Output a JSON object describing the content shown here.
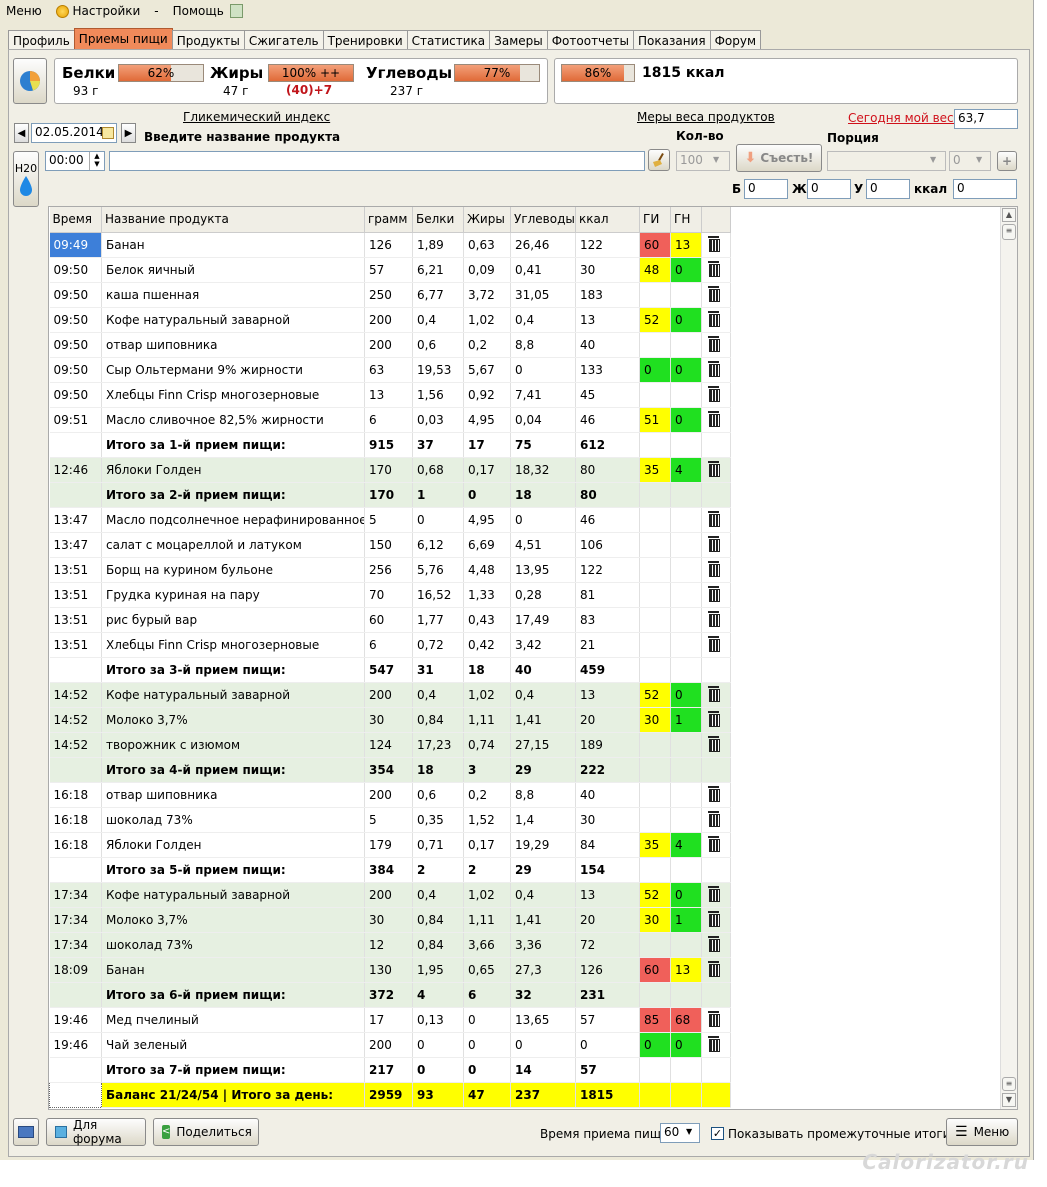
{
  "menu": {
    "menu": "Меню",
    "settings": "Настройки",
    "dash": "-",
    "help": "Помощь"
  },
  "tabs": [
    "Профиль",
    "Приемы пищи",
    "Продукты",
    "Сжигатель",
    "Тренировки",
    "Статистика",
    "Замеры",
    "Фотоотчеты",
    "Показания",
    "Форум"
  ],
  "summary": {
    "protein": {
      "label": "Белки",
      "pct": "62%",
      "fill": 62,
      "grams": "93 г"
    },
    "fat": {
      "label": "Жиры",
      "pct": "100% ++",
      "fill": 100,
      "grams": "47 г",
      "excess": "(40)+7"
    },
    "carbs": {
      "label": "Углеводы",
      "pct": "77%",
      "fill": 77,
      "grams": "237 г"
    },
    "kcal": {
      "pct": "86%",
      "fill": 86,
      "total": "1815 ккал"
    }
  },
  "form": {
    "glycemic_link": "Гликемический индекс",
    "weights_link": "Меры веса продуктов",
    "today_weight_link": "Сегодня мой вес:",
    "today_weight": "63,7",
    "date": "02.05.2014",
    "product_prompt": "Введите название продукта",
    "qty_label": "Кол-во",
    "portion_label": "Порция",
    "eat_button": "Съесть!",
    "qty": "100",
    "portion_qty": "0",
    "h2o": "H20",
    "time": "00:00",
    "b_label": "Б",
    "b": "0",
    "zh_label": "Ж",
    "zh": "0",
    "u_label": "У",
    "u": "0",
    "kcal_label": "ккал",
    "kcal": "0"
  },
  "table": {
    "headers": [
      "Время",
      "Название продукта",
      "грамм",
      "Белки",
      "Жиры",
      "Углеводы",
      "ккал",
      "ГИ",
      "ГН",
      ""
    ],
    "rows": [
      {
        "t": "09:49",
        "n": "Банан",
        "g": "126",
        "p": "1,89",
        "f": "0,63",
        "c": "26,46",
        "k": "122",
        "gi": "60",
        "gn": "13",
        "gic": "r",
        "gnc": "y",
        "sel": true
      },
      {
        "t": "09:50",
        "n": "Белок яичный",
        "g": "57",
        "p": "6,21",
        "f": "0,09",
        "c": "0,41",
        "k": "30",
        "gi": "48",
        "gn": "0",
        "gic": "y",
        "gnc": "g"
      },
      {
        "t": "09:50",
        "n": "каша пшенная",
        "g": "250",
        "p": "6,77",
        "f": "3,72",
        "c": "31,05",
        "k": "183",
        "gi": "",
        "gn": ""
      },
      {
        "t": "09:50",
        "n": "Кофе натуральный заварной",
        "g": "200",
        "p": "0,4",
        "f": "1,02",
        "c": "0,4",
        "k": "13",
        "gi": "52",
        "gn": "0",
        "gic": "y",
        "gnc": "g"
      },
      {
        "t": "09:50",
        "n": "отвар шиповника",
        "g": "200",
        "p": "0,6",
        "f": "0,2",
        "c": "8,8",
        "k": "40",
        "gi": "",
        "gn": ""
      },
      {
        "t": "09:50",
        "n": "Сыр Ольтермани 9% жирности",
        "g": "63",
        "p": "19,53",
        "f": "5,67",
        "c": "0",
        "k": "133",
        "gi": "0",
        "gn": "0",
        "gic": "g",
        "gnc": "g"
      },
      {
        "t": "09:50",
        "n": "Хлебцы Finn Crisp многозерновые",
        "g": "13",
        "p": "1,56",
        "f": "0,92",
        "c": "7,41",
        "k": "45",
        "gi": "",
        "gn": ""
      },
      {
        "t": "09:51",
        "n": "Масло сливочное 82,5% жирности",
        "g": "6",
        "p": "0,03",
        "f": "4,95",
        "c": "0,04",
        "k": "46",
        "gi": "51",
        "gn": "0",
        "gic": "y",
        "gnc": "g"
      },
      {
        "tot": true,
        "n": "Итого за 1-й прием пищи:",
        "g": "915",
        "p": "37",
        "f": "17",
        "c": "75",
        "k": "612"
      },
      {
        "t": "12:46",
        "n": "Яблоки Голден",
        "g": "170",
        "p": "0,68",
        "f": "0,17",
        "c": "18,32",
        "k": "80",
        "gi": "35",
        "gn": "4",
        "gic": "y",
        "gnc": "g",
        "grp": true
      },
      {
        "tot": true,
        "grp": true,
        "n": "Итого за 2-й прием пищи:",
        "g": "170",
        "p": "1",
        "f": "0",
        "c": "18",
        "k": "80"
      },
      {
        "t": "13:47",
        "n": "Масло подсолнечное нерафинированное",
        "g": "5",
        "p": "0",
        "f": "4,95",
        "c": "0",
        "k": "46",
        "gi": "",
        "gn": ""
      },
      {
        "t": "13:47",
        "n": "салат с моцареллой и латуком",
        "g": "150",
        "p": "6,12",
        "f": "6,69",
        "c": "4,51",
        "k": "106",
        "gi": "",
        "gn": ""
      },
      {
        "t": "13:51",
        "n": "Борщ на курином бульоне",
        "g": "256",
        "p": "5,76",
        "f": "4,48",
        "c": "13,95",
        "k": "122",
        "gi": "",
        "gn": ""
      },
      {
        "t": "13:51",
        "n": "Грудка куриная на пару",
        "g": "70",
        "p": "16,52",
        "f": "1,33",
        "c": "0,28",
        "k": "81",
        "gi": "",
        "gn": ""
      },
      {
        "t": "13:51",
        "n": "рис бурый вар",
        "g": "60",
        "p": "1,77",
        "f": "0,43",
        "c": "17,49",
        "k": "83",
        "gi": "",
        "gn": ""
      },
      {
        "t": "13:51",
        "n": "Хлебцы Finn Crisp многозерновые",
        "g": "6",
        "p": "0,72",
        "f": "0,42",
        "c": "3,42",
        "k": "21",
        "gi": "",
        "gn": ""
      },
      {
        "tot": true,
        "n": "Итого за 3-й прием пищи:",
        "g": "547",
        "p": "31",
        "f": "18",
        "c": "40",
        "k": "459"
      },
      {
        "t": "14:52",
        "n": "Кофе натуральный заварной",
        "g": "200",
        "p": "0,4",
        "f": "1,02",
        "c": "0,4",
        "k": "13",
        "gi": "52",
        "gn": "0",
        "gic": "y",
        "gnc": "g",
        "grp": true
      },
      {
        "t": "14:52",
        "n": "Молоко 3,7%",
        "g": "30",
        "p": "0,84",
        "f": "1,11",
        "c": "1,41",
        "k": "20",
        "gi": "30",
        "gn": "1",
        "gic": "y",
        "gnc": "g",
        "grp": true
      },
      {
        "t": "14:52",
        "n": "творожник с изюмом",
        "g": "124",
        "p": "17,23",
        "f": "0,74",
        "c": "27,15",
        "k": "189",
        "gi": "",
        "gn": "",
        "grp": true
      },
      {
        "tot": true,
        "grp": true,
        "n": "Итого за 4-й прием пищи:",
        "g": "354",
        "p": "18",
        "f": "3",
        "c": "29",
        "k": "222"
      },
      {
        "t": "16:18",
        "n": "отвар шиповника",
        "g": "200",
        "p": "0,6",
        "f": "0,2",
        "c": "8,8",
        "k": "40",
        "gi": "",
        "gn": ""
      },
      {
        "t": "16:18",
        "n": "шоколад 73%",
        "g": "5",
        "p": "0,35",
        "f": "1,52",
        "c": "1,4",
        "k": "30",
        "gi": "",
        "gn": ""
      },
      {
        "t": "16:18",
        "n": "Яблоки Голден",
        "g": "179",
        "p": "0,71",
        "f": "0,17",
        "c": "19,29",
        "k": "84",
        "gi": "35",
        "gn": "4",
        "gic": "y",
        "gnc": "g"
      },
      {
        "tot": true,
        "n": "Итого за 5-й прием пищи:",
        "g": "384",
        "p": "2",
        "f": "2",
        "c": "29",
        "k": "154"
      },
      {
        "t": "17:34",
        "n": "Кофе натуральный заварной",
        "g": "200",
        "p": "0,4",
        "f": "1,02",
        "c": "0,4",
        "k": "13",
        "gi": "52",
        "gn": "0",
        "gic": "y",
        "gnc": "g",
        "grp": true
      },
      {
        "t": "17:34",
        "n": "Молоко 3,7%",
        "g": "30",
        "p": "0,84",
        "f": "1,11",
        "c": "1,41",
        "k": "20",
        "gi": "30",
        "gn": "1",
        "gic": "y",
        "gnc": "g",
        "grp": true
      },
      {
        "t": "17:34",
        "n": "шоколад 73%",
        "g": "12",
        "p": "0,84",
        "f": "3,66",
        "c": "3,36",
        "k": "72",
        "gi": "",
        "gn": "",
        "grp": true
      },
      {
        "t": "18:09",
        "n": "Банан",
        "g": "130",
        "p": "1,95",
        "f": "0,65",
        "c": "27,3",
        "k": "126",
        "gi": "60",
        "gn": "13",
        "gic": "r",
        "gnc": "y",
        "grp": true
      },
      {
        "tot": true,
        "grp": true,
        "n": "Итого за 6-й прием пищи:",
        "g": "372",
        "p": "4",
        "f": "6",
        "c": "32",
        "k": "231"
      },
      {
        "t": "19:46",
        "n": "Мед пчелиный",
        "g": "17",
        "p": "0,13",
        "f": "0",
        "c": "13,65",
        "k": "57",
        "gi": "85",
        "gn": "68",
        "gic": "r",
        "gnc": "r"
      },
      {
        "t": "19:46",
        "n": "Чай зеленый",
        "g": "200",
        "p": "0",
        "f": "0",
        "c": "0",
        "k": "0",
        "gi": "0",
        "gn": "0",
        "gic": "g",
        "gnc": "g"
      },
      {
        "tot": true,
        "n": "Итого за 7-й прием пищи:",
        "g": "217",
        "p": "0",
        "f": "0",
        "c": "14",
        "k": "57"
      },
      {
        "day": true,
        "n": "Баланс 21/24/54  |  Итого за день:",
        "g": "2959",
        "p": "93",
        "f": "47",
        "c": "237",
        "k": "1815"
      }
    ]
  },
  "footer": {
    "forum_btn": "Для форума",
    "share_btn": "Поделиться",
    "meal_time_label": "Время приема пищи",
    "meal_time": "60",
    "show_totals": "Показывать промежуточные итоги",
    "menu_btn": "Меню"
  },
  "watermark": "Calorizator.ru"
}
